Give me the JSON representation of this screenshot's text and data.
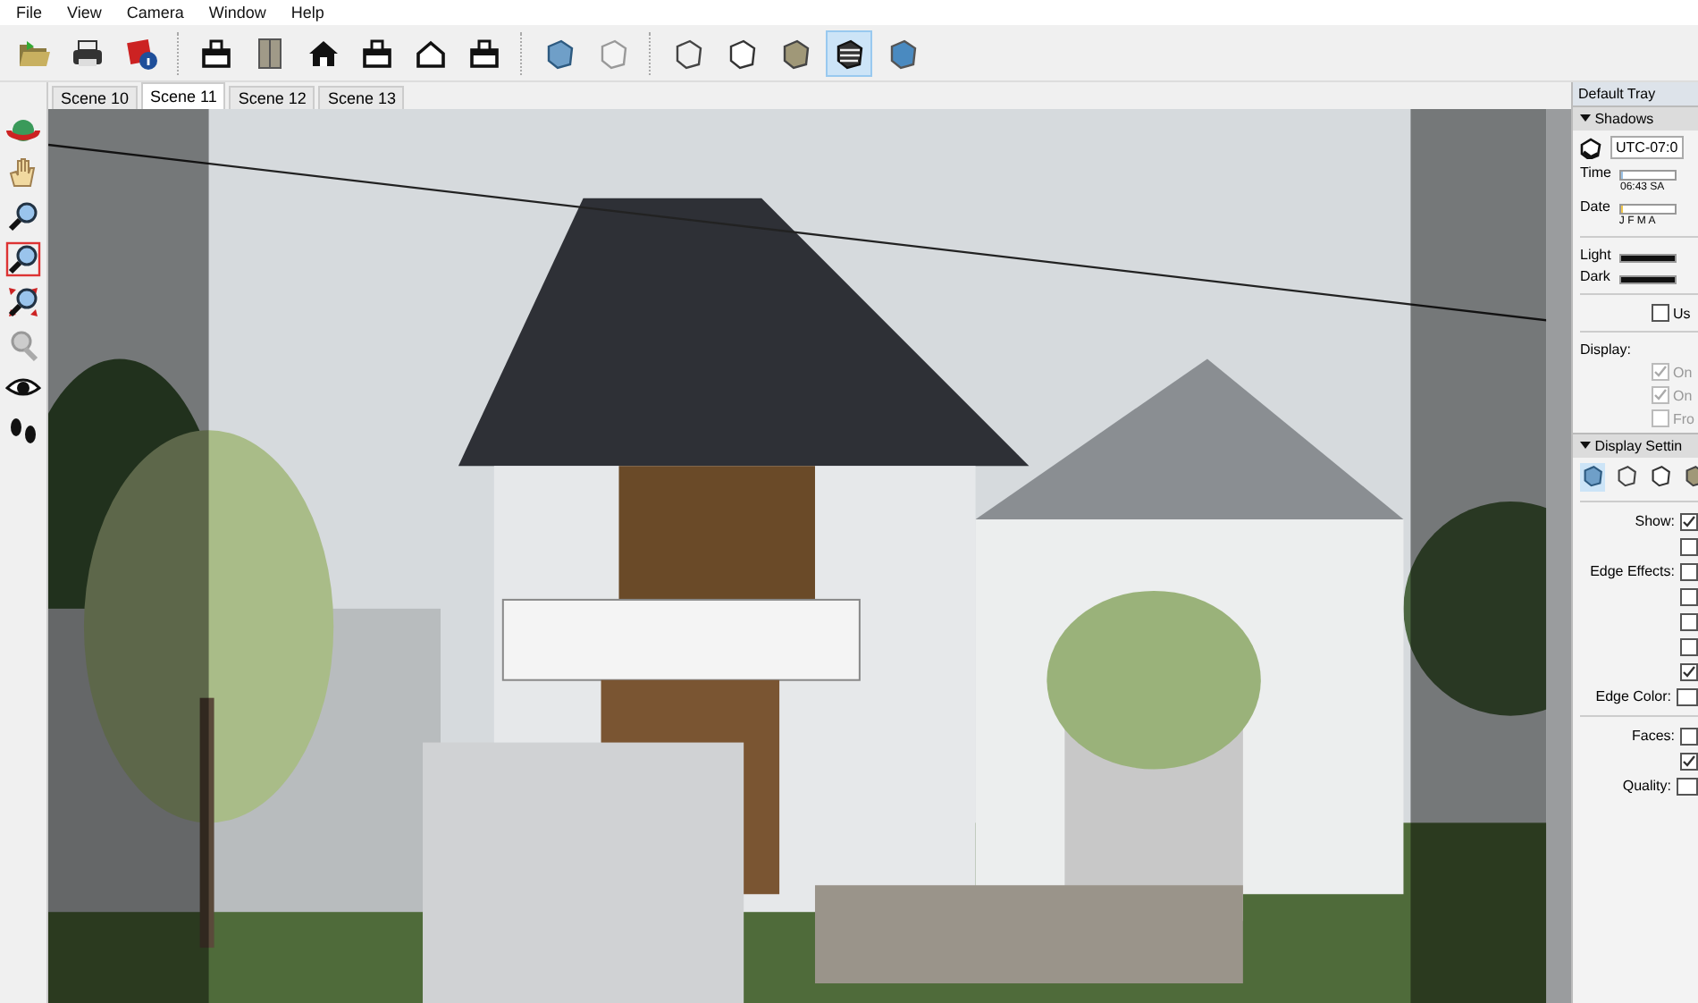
{
  "menu": [
    "File",
    "View",
    "Camera",
    "Window",
    "Help"
  ],
  "toolbar": [
    [
      {
        "kind": "open"
      },
      {
        "kind": "print"
      },
      {
        "kind": "info"
      }
    ],
    [
      {
        "kind": "iso"
      },
      {
        "kind": "box"
      },
      {
        "kind": "front"
      },
      {
        "kind": "top"
      },
      {
        "kind": "outline"
      },
      {
        "kind": "back"
      }
    ],
    [
      {
        "kind": "xray",
        "selected": false
      },
      {
        "kind": "backedge",
        "selected": false
      }
    ],
    [
      {
        "kind": "wire",
        "selected": false
      },
      {
        "kind": "hidden",
        "selected": false
      },
      {
        "kind": "shaded",
        "selected": false
      },
      {
        "kind": "textured",
        "selected": true
      },
      {
        "kind": "mono",
        "selected": false
      }
    ]
  ],
  "scene_tabs": [
    {
      "label": "Scene 10",
      "selected": false
    },
    {
      "label": "Scene 11",
      "selected": true
    },
    {
      "label": "Scene 12",
      "selected": false
    },
    {
      "label": "Scene 13",
      "selected": false
    }
  ],
  "left_tools": [
    {
      "kind": "orbit"
    },
    {
      "kind": "pan"
    },
    {
      "kind": "zoom"
    },
    {
      "kind": "zoom-window"
    },
    {
      "kind": "zoom-extents"
    },
    {
      "kind": "previous"
    },
    {
      "kind": "look-around"
    },
    {
      "kind": "walk"
    }
  ],
  "tray": {
    "title": "Default Tray",
    "shadows": {
      "title": "Shadows",
      "expanded": true,
      "timezone": "UTC-07:0",
      "time_label": "Time",
      "time_slider": {
        "level": 0.02
      },
      "time_value": "06:43 SA",
      "date_label": "Date",
      "date_slider": {
        "level": 0.02
      },
      "months": "J F M A",
      "light_label": "Light",
      "light_slider": {
        "level": 1
      },
      "dark_label": "Dark",
      "dark_slider": {
        "level": 1
      },
      "use_sun": {
        "label": "Us",
        "checked": false
      },
      "display_label": "Display:",
      "display_options": [
        {
          "label": "On",
          "checked": true,
          "disabled": true
        },
        {
          "label": "On",
          "checked": true,
          "disabled": true
        },
        {
          "label": "Fro",
          "checked": false,
          "disabled": true
        }
      ]
    },
    "display_settings": {
      "title": "Display Settin",
      "expanded": true,
      "styles": [
        {
          "kind": "xray",
          "selected": true
        },
        {
          "kind": "wire",
          "selected": false
        },
        {
          "kind": "hidden",
          "selected": false
        },
        {
          "kind": "shaded",
          "selected": false
        }
      ],
      "rows": [
        {
          "label": "Show:",
          "kind": "check",
          "checked": true
        },
        {
          "kind": "check",
          "checked": false
        },
        {
          "label": "Edge Effects:",
          "kind": "check",
          "checked": false
        },
        {
          "kind": "check",
          "checked": false
        },
        {
          "kind": "check",
          "checked": false
        },
        {
          "kind": "check",
          "checked": false
        },
        {
          "kind": "check",
          "checked": true
        },
        {
          "label": "Edge Color:",
          "kind": "dropdown"
        },
        {
          "kind": "rule"
        },
        {
          "label": "Faces:",
          "kind": "check",
          "checked": false
        },
        {
          "kind": "check",
          "checked": true
        },
        {
          "label": "Quality:",
          "kind": "dropdown"
        }
      ]
    }
  }
}
